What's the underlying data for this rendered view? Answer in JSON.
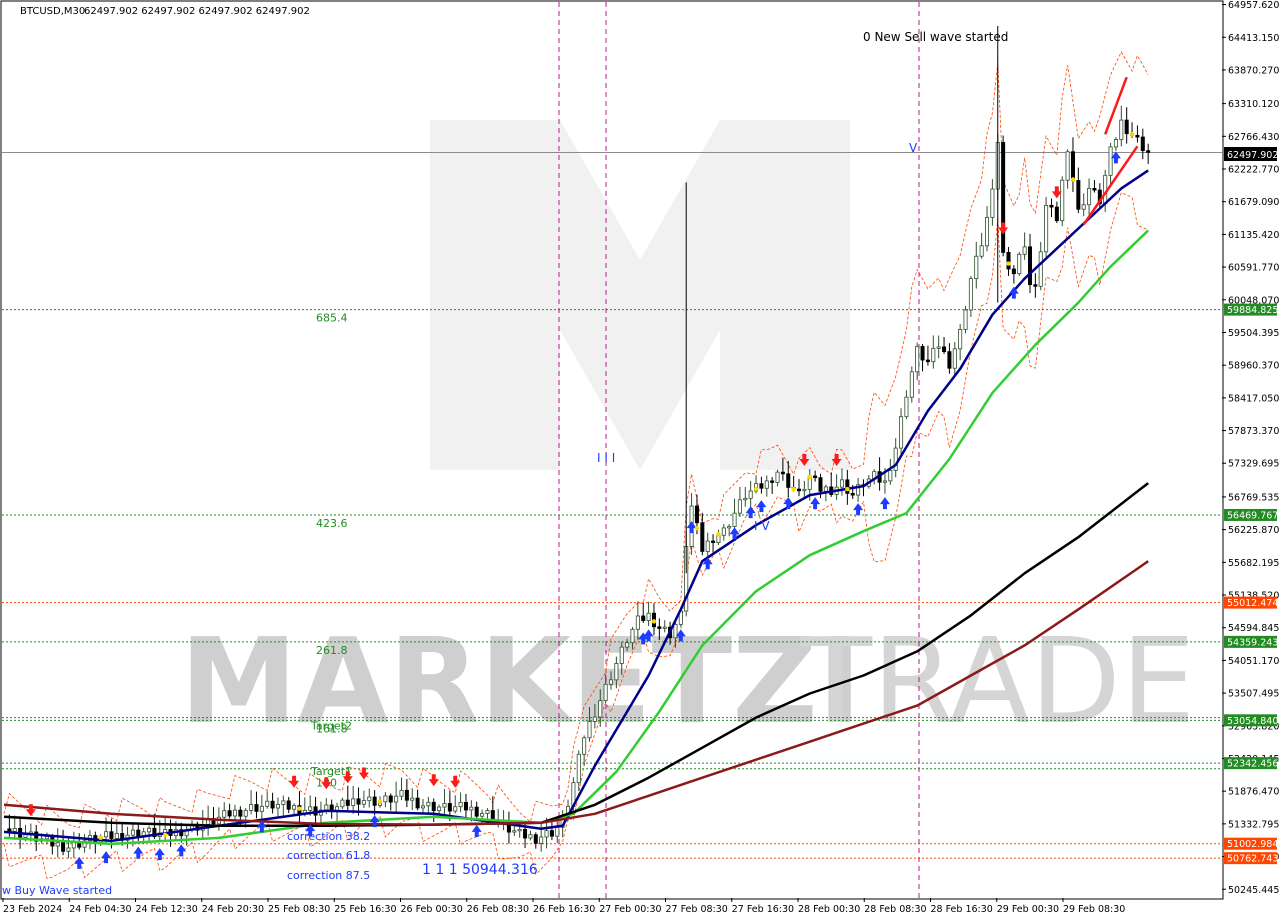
{
  "header": {
    "symbol": "BTCUSD,M30",
    "ohlc": "62497.902 62497.902 62497.902 62497.902"
  },
  "watermark": {
    "part1": "MARKETZI",
    "part2": "TRADE"
  },
  "colors": {
    "background": "#ffffff",
    "bull_candle": "#2f4f2f",
    "bear_candle": "#000000",
    "ma_fast": "#00008b",
    "ma_mid": "#32cd32",
    "ma_slow": "#000000",
    "ma_slowest": "#8b1a1a",
    "level_green": "#228b22",
    "level_red": "#ff4500",
    "vline": "#c71585",
    "envelope": "#ff4500",
    "buy_arrow": "#1e3cff",
    "sell_arrow": "#ff1a1a",
    "price_tag": "#000000"
  },
  "annotations": {
    "new_sell": "0 New Sell wave started",
    "new_buy": "w Buy Wave started",
    "wave_label": "1 1 1 50944.316",
    "roman_1": "I  I  I",
    "roman_2": "I V",
    "roman_3": "V"
  },
  "chart_data": {
    "type": "candlestick",
    "title": "BTCUSD,M30",
    "ylim": [
      50100,
      65000
    ],
    "y_ticks": [
      "64957.620",
      "64413.150",
      "63870.270",
      "63310.120",
      "62766.430",
      "62222.770",
      "61679.090",
      "61135.420",
      "60591.770",
      "60048.070",
      "59504.395",
      "58960.370",
      "58417.050",
      "57873.370",
      "57329.695",
      "56769.535",
      "56225.870",
      "55682.195",
      "55138.520",
      "54594.845",
      "54051.170",
      "53507.495",
      "52963.820",
      "52420.145",
      "51876.470",
      "51332.795",
      "50789.120",
      "50245.445"
    ],
    "x_ticks": [
      "23 Feb 2024",
      "24 Feb 04:30",
      "24 Feb 12:30",
      "24 Feb 20:30",
      "25 Feb 08:30",
      "25 Feb 16:30",
      "26 Feb 00:30",
      "26 Feb 08:30",
      "26 Feb 16:30",
      "27 Feb 00:30",
      "27 Feb 08:30",
      "27 Feb 16:30",
      "28 Feb 00:30",
      "28 Feb 08:30",
      "28 Feb 16:30",
      "29 Feb 00:30",
      "29 Feb 08:30"
    ],
    "current_price": "62497.902",
    "levels": [
      {
        "value": 59884.825,
        "label": "685.4",
        "tag": "59884.825",
        "color": "green"
      },
      {
        "value": 56469.767,
        "label": "423.6",
        "tag": "56469.767",
        "color": "green"
      },
      {
        "value": 55012.474,
        "label": "",
        "tag": "55012.474",
        "color": "red"
      },
      {
        "value": 54359.243,
        "label": "261.8",
        "tag": "54359.243",
        "color": "green"
      },
      {
        "value": 53100,
        "label": "Target2",
        "tag": "",
        "color": "green"
      },
      {
        "value": 53054.84,
        "label": "161.8",
        "tag": "53054.840",
        "color": "green"
      },
      {
        "value": 52342.456,
        "label": "Target1",
        "tag": "52342.456",
        "color": "green"
      },
      {
        "value": 52250,
        "label": "100",
        "tag": "",
        "color": "green"
      },
      {
        "value": 51002.984,
        "label": "",
        "tag": "51002.984",
        "color": "red"
      },
      {
        "value": 50762.743,
        "label": "",
        "tag": "50762.743",
        "color": "red"
      }
    ],
    "corrections": [
      "correction 38.2",
      "correction 61.8",
      "correction 87.5"
    ],
    "close_path": [
      [
        0,
        51250
      ],
      [
        3,
        51180
      ],
      [
        6,
        51100
      ],
      [
        9,
        51000
      ],
      [
        12,
        50950
      ],
      [
        15,
        51050
      ],
      [
        18,
        51100
      ],
      [
        22,
        51150
      ],
      [
        26,
        51200
      ],
      [
        30,
        51150
      ],
      [
        34,
        51250
      ],
      [
        38,
        51350
      ],
      [
        42,
        51500
      ],
      [
        46,
        51600
      ],
      [
        50,
        51650
      ],
      [
        54,
        51600
      ],
      [
        58,
        51550
      ],
      [
        62,
        51600
      ],
      [
        66,
        51750
      ],
      [
        70,
        51700
      ],
      [
        74,
        51800
      ],
      [
        78,
        51650
      ],
      [
        82,
        51600
      ],
      [
        86,
        51600
      ],
      [
        90,
        51500
      ],
      [
        93,
        51300
      ],
      [
        96,
        51150
      ],
      [
        99,
        51100
      ],
      [
        102,
        51200
      ],
      [
        104,
        51350
      ],
      [
        106,
        52000
      ],
      [
        108,
        52800
      ],
      [
        110,
        53200
      ],
      [
        112,
        53600
      ],
      [
        114,
        54000
      ],
      [
        116,
        54400
      ],
      [
        118,
        54700
      ],
      [
        120,
        54800
      ],
      [
        122,
        54600
      ],
      [
        124,
        54500
      ],
      [
        126,
        54800
      ],
      [
        127,
        56000
      ],
      [
        128,
        56600
      ],
      [
        130,
        55900
      ],
      [
        132,
        56100
      ],
      [
        134,
        56200
      ],
      [
        136,
        56500
      ],
      [
        138,
        56800
      ],
      [
        140,
        56900
      ],
      [
        142,
        57000
      ],
      [
        144,
        57200
      ],
      [
        146,
        57000
      ],
      [
        148,
        56800
      ],
      [
        150,
        57100
      ],
      [
        152,
        56900
      ],
      [
        154,
        56900
      ],
      [
        156,
        57000
      ],
      [
        158,
        56800
      ],
      [
        160,
        57000
      ],
      [
        162,
        57100
      ],
      [
        164,
        57000
      ],
      [
        166,
        57600
      ],
      [
        168,
        58500
      ],
      [
        170,
        59200
      ],
      [
        172,
        59000
      ],
      [
        174,
        59300
      ],
      [
        176,
        59000
      ],
      [
        178,
        59500
      ],
      [
        180,
        60400
      ],
      [
        182,
        61000
      ],
      [
        184,
        61800
      ],
      [
        185,
        62700
      ],
      [
        186,
        60800
      ],
      [
        188,
        60500
      ],
      [
        190,
        61000
      ],
      [
        191,
        60300
      ],
      [
        192,
        60200
      ],
      [
        194,
        61600
      ],
      [
        196,
        61400
      ],
      [
        198,
        62600
      ],
      [
        200,
        61500
      ],
      [
        202,
        61900
      ],
      [
        204,
        61700
      ],
      [
        206,
        62500
      ],
      [
        208,
        63000
      ],
      [
        210,
        62800
      ],
      [
        211,
        62700
      ],
      [
        212,
        62600
      ],
      [
        213,
        62497.902
      ]
    ],
    "series": [
      {
        "name": "MA fast",
        "color": "#00008b",
        "values": [
          [
            0,
            51200
          ],
          [
            20,
            51050
          ],
          [
            40,
            51300
          ],
          [
            60,
            51550
          ],
          [
            80,
            51500
          ],
          [
            100,
            51250
          ],
          [
            104,
            51300
          ],
          [
            110,
            52300
          ],
          [
            120,
            53800
          ],
          [
            126,
            54900
          ],
          [
            130,
            55700
          ],
          [
            140,
            56300
          ],
          [
            150,
            56800
          ],
          [
            160,
            56950
          ],
          [
            166,
            57300
          ],
          [
            172,
            58200
          ],
          [
            178,
            58900
          ],
          [
            184,
            59800
          ],
          [
            190,
            60400
          ],
          [
            196,
            60900
          ],
          [
            202,
            61400
          ],
          [
            208,
            61900
          ],
          [
            213,
            62200
          ]
        ]
      },
      {
        "name": "MA mid",
        "color": "#32cd32",
        "values": [
          [
            0,
            51100
          ],
          [
            20,
            51000
          ],
          [
            40,
            51100
          ],
          [
            60,
            51350
          ],
          [
            80,
            51450
          ],
          [
            100,
            51350
          ],
          [
            106,
            51500
          ],
          [
            114,
            52200
          ],
          [
            122,
            53200
          ],
          [
            130,
            54300
          ],
          [
            140,
            55200
          ],
          [
            150,
            55800
          ],
          [
            160,
            56200
          ],
          [
            168,
            56500
          ],
          [
            176,
            57400
          ],
          [
            184,
            58500
          ],
          [
            192,
            59300
          ],
          [
            200,
            60000
          ],
          [
            206,
            60600
          ],
          [
            213,
            61200
          ]
        ]
      },
      {
        "name": "MA slow",
        "color": "#000000",
        "values": [
          [
            0,
            51450
          ],
          [
            20,
            51350
          ],
          [
            40,
            51300
          ],
          [
            60,
            51300
          ],
          [
            80,
            51320
          ],
          [
            100,
            51350
          ],
          [
            110,
            51650
          ],
          [
            120,
            52100
          ],
          [
            130,
            52600
          ],
          [
            140,
            53100
          ],
          [
            150,
            53500
          ],
          [
            160,
            53800
          ],
          [
            170,
            54200
          ],
          [
            180,
            54800
          ],
          [
            190,
            55500
          ],
          [
            200,
            56100
          ],
          [
            213,
            57000
          ]
        ]
      },
      {
        "name": "MA slowest",
        "color": "#8b1a1a",
        "values": [
          [
            0,
            51650
          ],
          [
            20,
            51500
          ],
          [
            40,
            51400
          ],
          [
            60,
            51330
          ],
          [
            80,
            51320
          ],
          [
            100,
            51350
          ],
          [
            110,
            51500
          ],
          [
            120,
            51800
          ],
          [
            130,
            52100
          ],
          [
            140,
            52400
          ],
          [
            150,
            52700
          ],
          [
            160,
            53000
          ],
          [
            170,
            53300
          ],
          [
            180,
            53800
          ],
          [
            190,
            54300
          ],
          [
            200,
            54900
          ],
          [
            213,
            55700
          ]
        ]
      }
    ]
  }
}
